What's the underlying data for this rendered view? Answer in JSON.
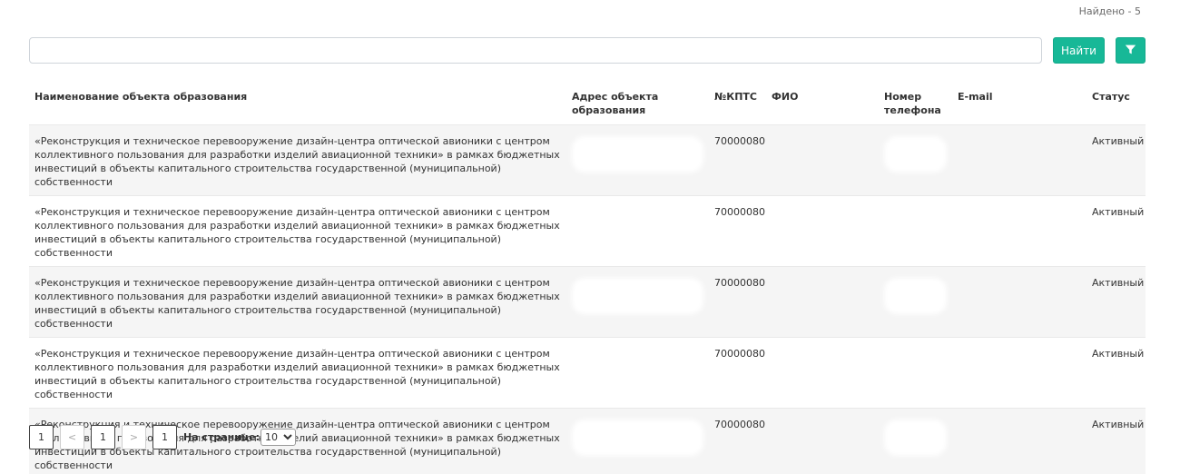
{
  "header": {
    "found_text": "Найдено - 5"
  },
  "search": {
    "placeholder": "",
    "value": "",
    "find_label": "Найти"
  },
  "colors": {
    "accent": "#17b897",
    "row_alt": "#f5f5f5"
  },
  "icons": {
    "filter": "filter-icon"
  },
  "table": {
    "columns": [
      "Наименование объекта образования",
      "Адрес объекта образования",
      "№КПТС",
      "ФИО",
      "Номер телефона",
      "E-mail",
      "Статус"
    ],
    "rows": [
      {
        "name": "«Реконструкция и техническое перевооружение дизайн-центра оптической авионики с центром коллективного пользования для разработки изделий авиационной техники» в рамках бюджетных инвестиций в объекты капитального строительства государственной (муниципальной) собственности",
        "address": "",
        "kpts": "70000080",
        "fio": "",
        "phone": "",
        "email": "",
        "status": "Активный"
      },
      {
        "name": "«Реконструкция и техническое перевооружение дизайн-центра оптической авионики с центром коллективного пользования для разработки изделий авиационной техники» в рамках бюджетных инвестиций в объекты капитального строительства государственной (муниципальной) собственности",
        "address": "",
        "kpts": "70000080",
        "fio": "",
        "phone": "",
        "email": "",
        "status": "Активный"
      },
      {
        "name": "«Реконструкция и техническое перевооружение дизайн-центра оптической авионики с центром коллективного пользования для разработки изделий авиационной техники» в рамках бюджетных инвестиций в объекты капитального строительства государственной (муниципальной) собственности",
        "address": "",
        "kpts": "70000080",
        "fio": "",
        "phone": "",
        "email": "",
        "status": "Активный"
      },
      {
        "name": "«Реконструкция и техническое перевооружение дизайн-центра оптической авионики с центром коллективного пользования для разработки изделий авиационной техники» в рамках бюджетных инвестиций в объекты капитального строительства государственной (муниципальной) собственности",
        "address": "",
        "kpts": "70000080",
        "fio": "",
        "phone": "",
        "email": "",
        "status": "Активный"
      },
      {
        "name": "«Реконструкция и техническое перевооружение дизайн-центра оптической авионики с центром коллективного пользования для разработки изделий авиационной техники» в рамках бюджетных инвестиций в объекты капитального строительства государственной (муниципальной) собственности",
        "address": "",
        "kpts": "70000080",
        "fio": "",
        "phone": "",
        "email": "",
        "status": "Активный"
      }
    ]
  },
  "pagination": {
    "first": "1",
    "prev": "<",
    "current": "1",
    "next": ">",
    "last": "1",
    "per_page_label": "На странице:",
    "per_page_value": "10"
  }
}
